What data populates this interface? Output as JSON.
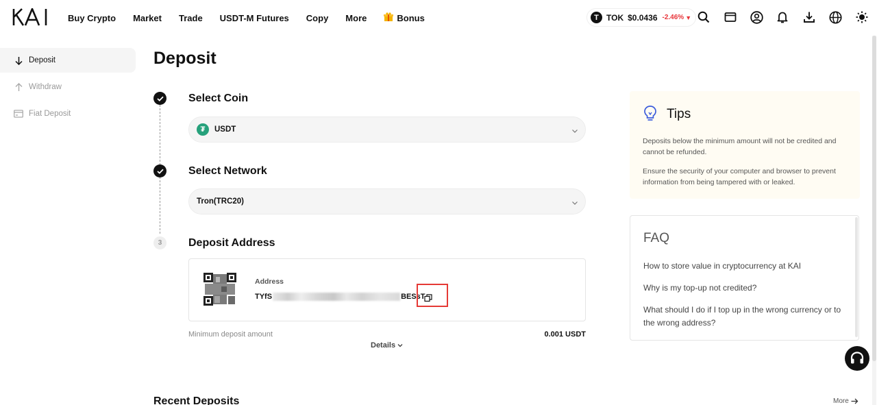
{
  "header": {
    "logo": "KAI",
    "nav": [
      {
        "label": "Buy Crypto"
      },
      {
        "label": "Market"
      },
      {
        "label": "Trade"
      },
      {
        "label": "USDT-M Futures"
      },
      {
        "label": "Copy"
      },
      {
        "label": "More"
      },
      {
        "label": "Bonus",
        "icon": "gift-icon"
      }
    ],
    "ticker": {
      "symbol": "TOK",
      "price": "$0.0436",
      "change": "-2.46%",
      "icon": "tok-coin-icon",
      "change_color": "#e8363b"
    },
    "icons": [
      "search-icon",
      "wallet-icon",
      "user-icon",
      "bell-icon",
      "download-icon",
      "globe-icon",
      "theme-icon"
    ]
  },
  "sidebar": {
    "items": [
      {
        "label": "Deposit",
        "icon": "arrow-down-icon",
        "active": true
      },
      {
        "label": "Withdraw",
        "icon": "arrow-up-icon",
        "active": false
      },
      {
        "label": "Fiat Deposit",
        "icon": "card-icon",
        "active": false
      }
    ]
  },
  "main": {
    "title": "Deposit",
    "steps": [
      {
        "number": "1",
        "title": "Select Coin",
        "done": true
      },
      {
        "number": "2",
        "title": "Select Network",
        "done": true
      },
      {
        "number": "3",
        "title": "Deposit Address",
        "done": false
      }
    ],
    "coin": {
      "value": "USDT",
      "icon": "usdt-icon",
      "icon_color": "#26a17b"
    },
    "network": {
      "value": "Tron(TRC20)"
    },
    "address": {
      "label": "Address",
      "prefix": "TYfS",
      "suffix": "BESsT"
    },
    "min_deposit": {
      "label": "Minimum deposit amount",
      "value": "0.001 USDT"
    },
    "details_label": "Details",
    "recent_title": "Recent Deposits",
    "more_label": "More"
  },
  "tips": {
    "title": "Tips",
    "items": [
      "Deposits below the minimum amount will not be credited and cannot be refunded.",
      "Ensure the security of your computer and browser to prevent information from being tampered with or leaked."
    ]
  },
  "faq": {
    "title": "FAQ",
    "items": [
      "How to store value in cryptocurrency at KAI",
      "Why is my top-up not credited?",
      "What should I do if I top up in the wrong currency or to the wrong address?"
    ]
  },
  "colors": {
    "highlight": "#e53935",
    "accent": "#111111"
  }
}
